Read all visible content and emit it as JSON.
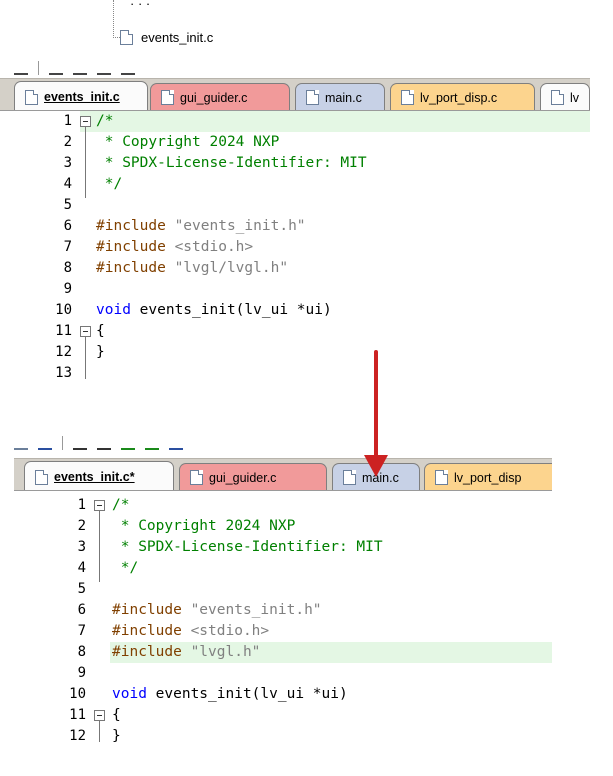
{
  "tree": {
    "partial_text": "·  ·  ·",
    "file": "events_init.c"
  },
  "panel1": {
    "tabs": [
      {
        "label": "events_init.c",
        "color": "#fbfbfb"
      },
      {
        "label": "gui_guider.c",
        "color": "#f19a9a"
      },
      {
        "label": "main.c",
        "color": "#c7d1e6"
      },
      {
        "label": "lv_port_disp.c",
        "color": "#fcd48e"
      },
      {
        "label": "lv",
        "color": "#fbfbfb"
      }
    ],
    "lines": [
      {
        "n": "1",
        "text": "/*"
      },
      {
        "n": "2",
        "text": " * Copyright 2024 NXP"
      },
      {
        "n": "3",
        "text": " * SPDX-License-Identifier: MIT"
      },
      {
        "n": "4",
        "text": " */"
      },
      {
        "n": "5",
        "text": ""
      },
      {
        "n": "6",
        "pre": "#include ",
        "str": "\"events_init.h\""
      },
      {
        "n": "7",
        "pre": "#include ",
        "str": "<stdio.h>"
      },
      {
        "n": "8",
        "pre": "#include ",
        "str": "\"lvgl/lvgl.h\""
      },
      {
        "n": "9",
        "text": ""
      },
      {
        "n": "10",
        "kw": "void",
        "rest": " events_init(lv_ui *ui)"
      },
      {
        "n": "11",
        "text": "{"
      },
      {
        "n": "12",
        "text": "}"
      },
      {
        "n": "13",
        "text": ""
      }
    ]
  },
  "panel2": {
    "tabs": [
      {
        "label": "events_init.c*",
        "color": "#fbfbfb"
      },
      {
        "label": "gui_guider.c",
        "color": "#f19a9a"
      },
      {
        "label": "main.c",
        "color": "#c7d1e6"
      },
      {
        "label": "lv_port_disp",
        "color": "#fcd48e"
      }
    ],
    "lines": [
      {
        "n": "1",
        "text": "/*"
      },
      {
        "n": "2",
        "text": " * Copyright 2024 NXP"
      },
      {
        "n": "3",
        "text": " * SPDX-License-Identifier: MIT"
      },
      {
        "n": "4",
        "text": " */"
      },
      {
        "n": "5",
        "text": ""
      },
      {
        "n": "6",
        "pre": "#include ",
        "str": "\"events_init.h\""
      },
      {
        "n": "7",
        "pre": "#include ",
        "str": "<stdio.h>"
      },
      {
        "n": "8",
        "pre": "#include ",
        "str": "\"lvgl.h\""
      },
      {
        "n": "9",
        "text": ""
      },
      {
        "n": "10",
        "kw": "void",
        "rest": " events_init(lv_ui *ui)"
      },
      {
        "n": "11",
        "text": "{"
      },
      {
        "n": "12",
        "text": "}"
      }
    ]
  },
  "colors": {
    "comment": "#008000",
    "preprocessor": "#804000",
    "string": "#808080",
    "keyword": "#0000ff",
    "highlight": "#e4f7e4",
    "arrow": "#cc2222"
  }
}
